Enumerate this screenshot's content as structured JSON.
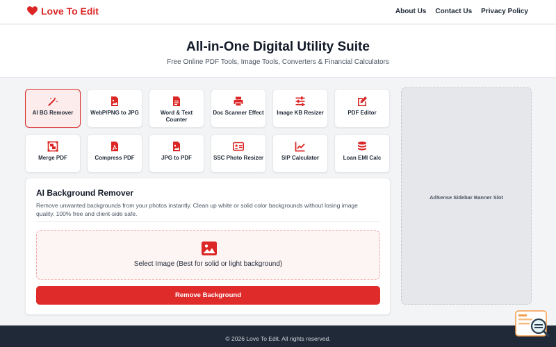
{
  "header": {
    "brand": "Love To Edit",
    "nav": [
      "About Us",
      "Contact Us",
      "Privacy Policy"
    ]
  },
  "hero": {
    "title": "All-in-One Digital Utility Suite",
    "subtitle": "Free Online PDF Tools, Image Tools, Converters & Financial Calculators"
  },
  "tools": [
    {
      "label": "AI BG Remover",
      "icon": "magic-wand-icon",
      "active": true
    },
    {
      "label": "WebP/PNG to JPG",
      "icon": "image-file-icon",
      "active": false
    },
    {
      "label": "Word & Text Counter",
      "icon": "document-icon",
      "active": false
    },
    {
      "label": "Doc Scanner Effect",
      "icon": "printer-icon",
      "active": false
    },
    {
      "label": "Image KB Resizer",
      "icon": "sliders-icon",
      "active": false
    },
    {
      "label": "PDF Editor",
      "icon": "edit-icon",
      "active": false
    },
    {
      "label": "Merge PDF",
      "icon": "object-group-icon",
      "active": false
    },
    {
      "label": "Compress PDF",
      "icon": "pdf-file-icon",
      "active": false
    },
    {
      "label": "JPG to PDF",
      "icon": "image-file-icon",
      "active": false
    },
    {
      "label": "SSC Photo Resizer",
      "icon": "id-card-icon",
      "active": false
    },
    {
      "label": "SIP Calculator",
      "icon": "chart-line-icon",
      "active": false
    },
    {
      "label": "Loan EMI Calc",
      "icon": "coins-icon",
      "active": false
    }
  ],
  "panel": {
    "title": "AI Background Remover",
    "description": "Remove unwanted backgrounds from your photos instantly. Clean up white or solid color backgrounds without losing image quality. 100% free and client-side safe.",
    "upload_label": "Select Image (Best for solid or light background)",
    "action_label": "Remove Background"
  },
  "ad": {
    "label": "AdSense Sidebar Banner Slot"
  },
  "footer": {
    "copyright": "© 2026 Love To Edit. All rights reserved."
  },
  "colors": {
    "accent": "#dc2626",
    "button": "#e02b2b",
    "footer_bg": "#1f2937"
  }
}
